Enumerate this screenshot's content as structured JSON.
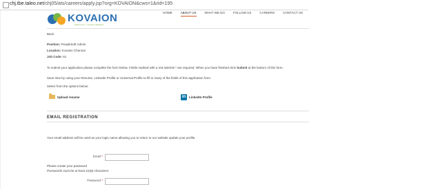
{
  "browser": {
    "url_domain": "chj.tbe.taleo.net",
    "url_path": "/chj05/ats/careers/apply.jsp?org=KOVAION&cws=1&rid=195"
  },
  "header": {
    "logo_text": "KOVAION",
    "tagline": "AMPLIFY YOUR NEEDS",
    "nav": [
      "HOME",
      "ABOUT US",
      "WHAT WE DO",
      "FOLLOW US",
      "CAREERS",
      "CONTACT US"
    ]
  },
  "main": {
    "back": "Back",
    "position_label": "Position:",
    "position_value": "PeopleSoft Admin",
    "location_label": "Location:",
    "location_value": "Kovaion Chennai",
    "jobcode_label": "Job Code:",
    "jobcode_value": "81",
    "instructions_a": "To submit your application please complete the form below. Fields marked with a red asterisk * are required. When you have finished click",
    "instructions_submit": "Submit",
    "instructions_b": "at the bottom of this form.",
    "save_time": "Save time by using your Resume, LinkedIn Profile or Universal Profile to fill in many of the fields of this application form.",
    "select_options": "Select from the options below:",
    "upload_resume": "Upload resume",
    "linkedin_profile": "LinkedIn Profile",
    "linkedin_icon_text": "in"
  },
  "registration": {
    "title": "EMAIL REGISTRATION",
    "info": "Your email address will be used as your login name allowing you to return to our website update your profile.",
    "email_label": "Email",
    "password_prompt": "Please create your password",
    "password_hint": "Passwords must be at least six(6) characters",
    "password_label": "Password",
    "required_mark": "*"
  }
}
